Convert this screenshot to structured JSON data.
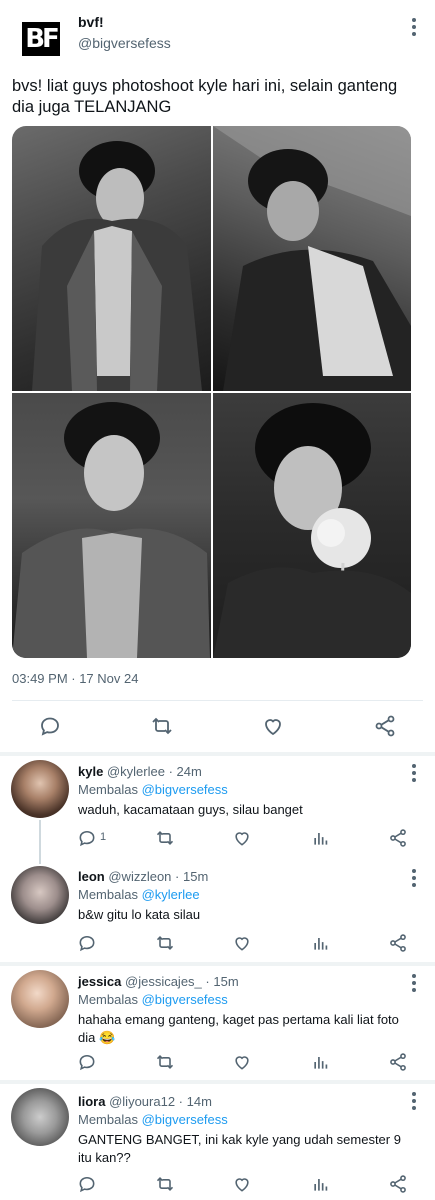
{
  "tweet": {
    "logo_text": "BF",
    "author_name": "bvf!",
    "author_handle": "@bigversefess",
    "text": "bvs! liat guys photoshoot kyle hari ini, selain ganteng dia juga TELANJANG",
    "timestamp": "03:49 PM · 17 Nov 24",
    "photos": [
      "photo-1",
      "photo-2",
      "photo-3",
      "photo-4"
    ],
    "actions": [
      "reply-icon",
      "retweet-icon",
      "like-icon",
      "share-icon"
    ]
  },
  "replies": [
    {
      "name": "kyle",
      "handle": "@kylerlee",
      "time": "24m",
      "replying_label": "Membalas",
      "replying_to": "@bigversefess",
      "text": "waduh, kacamataan guys, silau banget",
      "reply_count": "1"
    },
    {
      "name": "leon",
      "handle": "@wizzleon",
      "time": "15m",
      "replying_label": "Membalas",
      "replying_to": "@kylerlee",
      "text": "b&w gitu lo kata silau",
      "reply_count": ""
    },
    {
      "name": "jessica",
      "handle": "@jessicajes_",
      "time": "15m",
      "replying_label": "Membalas",
      "replying_to": "@bigversefess",
      "text": "hahaha emang ganteng, kaget pas pertama kali liat foto dia 😂",
      "reply_count": ""
    },
    {
      "name": "liora",
      "handle": "@liyoura12",
      "time": "14m",
      "replying_label": "Membalas",
      "replying_to": "@bigversefess",
      "text": "GANTENG BANGET, ini kak kyle yang udah semester 9 itu kan??",
      "reply_count": ""
    }
  ],
  "colors": {
    "accent": "#1d9bf0",
    "secondary_text": "#536471",
    "primary_text": "#0f1419"
  }
}
